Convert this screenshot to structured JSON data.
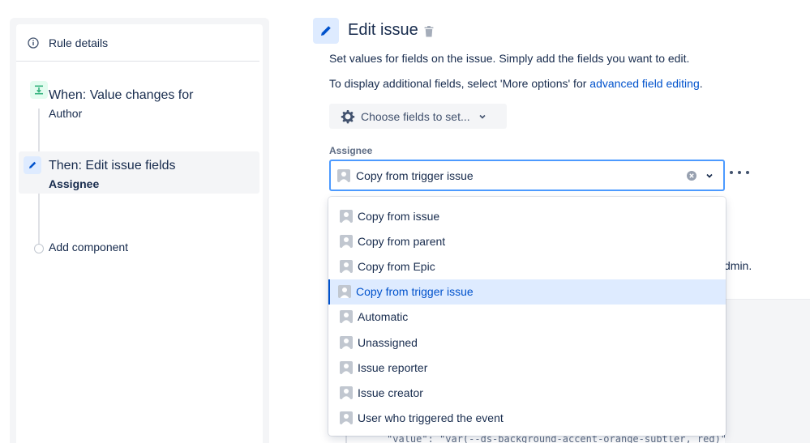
{
  "sidebar": {
    "rule_details_label": "Rule details",
    "steps": [
      {
        "title": "When: Value changes for",
        "subtitle": "Author",
        "icon": "trigger-icon",
        "color": "#36b37e"
      },
      {
        "title": "Then: Edit issue fields",
        "subtitle": "Assignee",
        "icon": "pencil-icon",
        "color": "#0052cc"
      },
      {
        "title": "Add component",
        "icon": "circle-icon"
      }
    ]
  },
  "main": {
    "title": "Edit issue",
    "description": "Set values for fields on the issue. Simply add the fields you want to edit.",
    "more_options_text": "To display additional fields, select 'More options' for ",
    "advanced_link": "advanced field editing",
    "period": ".",
    "choose_fields_label": "Choose fields to set...",
    "field": {
      "label": "Assignee",
      "value": "Copy from trigger issue"
    },
    "background_text_fragment": "dmin.",
    "background_code_fragment": "\"value\": \"var(--ds-background-accent-orange-subtler, red)\""
  },
  "dropdown": {
    "options": [
      "Copy from issue",
      "Copy from parent",
      "Copy from Epic",
      "Copy from trigger issue",
      "Automatic",
      "Unassigned",
      "Issue reporter",
      "Issue creator",
      "User who triggered the event"
    ],
    "selected": "Copy from trigger issue"
  },
  "colors": {
    "accent": "#0052cc",
    "focus_border": "#4c9aff",
    "selected_bg": "#deebff"
  }
}
